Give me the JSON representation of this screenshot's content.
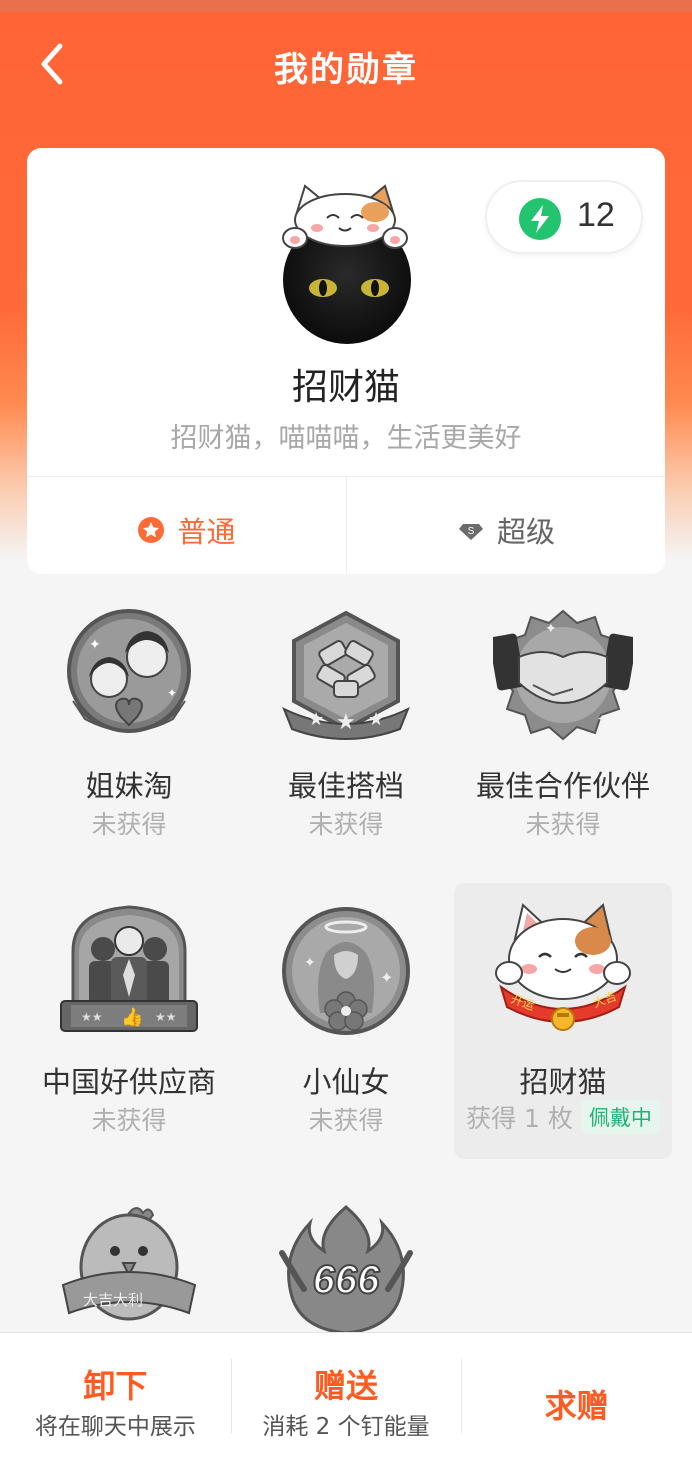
{
  "header": {
    "title": "我的勋章",
    "back_icon": "chevron-left-icon"
  },
  "profile": {
    "energy_count": "12",
    "energy_icon": "lightning-icon",
    "name": "招财猫",
    "description": "招财猫，喵喵喵，生活更美好"
  },
  "tabs": [
    {
      "label": "普通",
      "icon": "star-badge-icon",
      "active": true
    },
    {
      "label": "超级",
      "icon": "diamond-icon",
      "active": false
    }
  ],
  "badges": [
    {
      "name": "姐妹淘",
      "status": "未获得",
      "icon": "sisters-badge-icon"
    },
    {
      "name": "最佳搭档",
      "status": "未获得",
      "icon": "teamwork-badge-icon"
    },
    {
      "name": "最佳合作伙伴",
      "status": "未获得",
      "icon": "handshake-badge-icon"
    },
    {
      "name": "中国好供应商",
      "status": "未获得",
      "icon": "supplier-badge-icon"
    },
    {
      "name": "小仙女",
      "status": "未获得",
      "icon": "fairy-badge-icon"
    },
    {
      "name": "招财猫",
      "status": "获得 1 枚",
      "tag": "佩戴中",
      "icon": "lucky-cat-badge-icon"
    },
    {
      "name": "",
      "status": "",
      "icon": "lucky-chick-badge-icon",
      "banner": "大吉大利"
    },
    {
      "name": "",
      "status": "",
      "icon": "666-fire-badge-icon",
      "banner": "666"
    }
  ],
  "actions": {
    "unequip": {
      "title": "卸下",
      "sub": "将在聊天中展示"
    },
    "gift": {
      "title": "赠送",
      "sub": "消耗 2 个钉能量"
    },
    "request": {
      "title": "求赠"
    }
  },
  "colors": {
    "accent": "#ff6435",
    "action_text": "#ff5a1f",
    "wearing_green": "#1fb376"
  }
}
